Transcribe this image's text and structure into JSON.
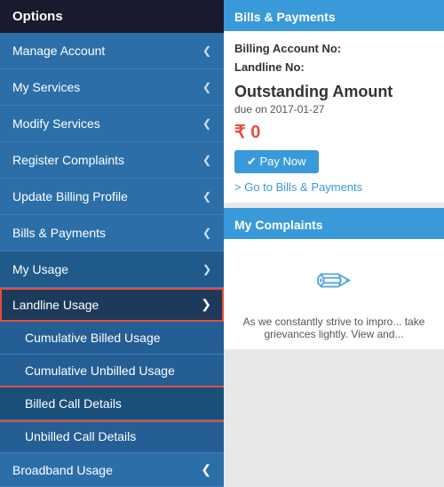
{
  "sidebar": {
    "header": "Options",
    "items": [
      {
        "label": "Manage Account",
        "chevron": "❮",
        "state": "collapsed"
      },
      {
        "label": "My Services",
        "chevron": "❮",
        "state": "collapsed"
      },
      {
        "label": "Modify Services",
        "chevron": "❮",
        "state": "collapsed"
      },
      {
        "label": "Register Complaints",
        "chevron": "❮",
        "state": "collapsed"
      },
      {
        "label": "Update Billing Profile",
        "chevron": "❮",
        "state": "collapsed"
      },
      {
        "label": "Bills & Payments",
        "chevron": "❮",
        "state": "collapsed"
      },
      {
        "label": "My Usage",
        "chevron": "❯",
        "state": "expanded"
      }
    ],
    "subMenu": {
      "header": "Landline Usage",
      "headerChevron": "❯",
      "items": [
        {
          "label": "Cumulative Billed Usage",
          "highlighted": false
        },
        {
          "label": "Cumulative Unbilled Usage",
          "highlighted": false
        },
        {
          "label": "Billed Call Details",
          "highlighted": true
        },
        {
          "label": "Unbilled Call Details",
          "highlighted": false
        }
      ],
      "broadband": {
        "label": "Broadband Usage",
        "chevron": "❮"
      }
    }
  },
  "billsPayments": {
    "header": "Bills & Payments",
    "billingAccountLabel": "Billing Account No:",
    "landlineLabel": "Landline No:",
    "outstandingLabel": "Outstanding Amount",
    "dueDate": "due on 2017-01-27",
    "amount": "₹ 0",
    "payNowLabel": "✔ Pay Now",
    "goToLink": "> Go to Bills & Payments"
  },
  "myComplaints": {
    "header": "My Complaints",
    "bodyText": "As we constantly strive to impro... take grievances lightly. View and..."
  }
}
